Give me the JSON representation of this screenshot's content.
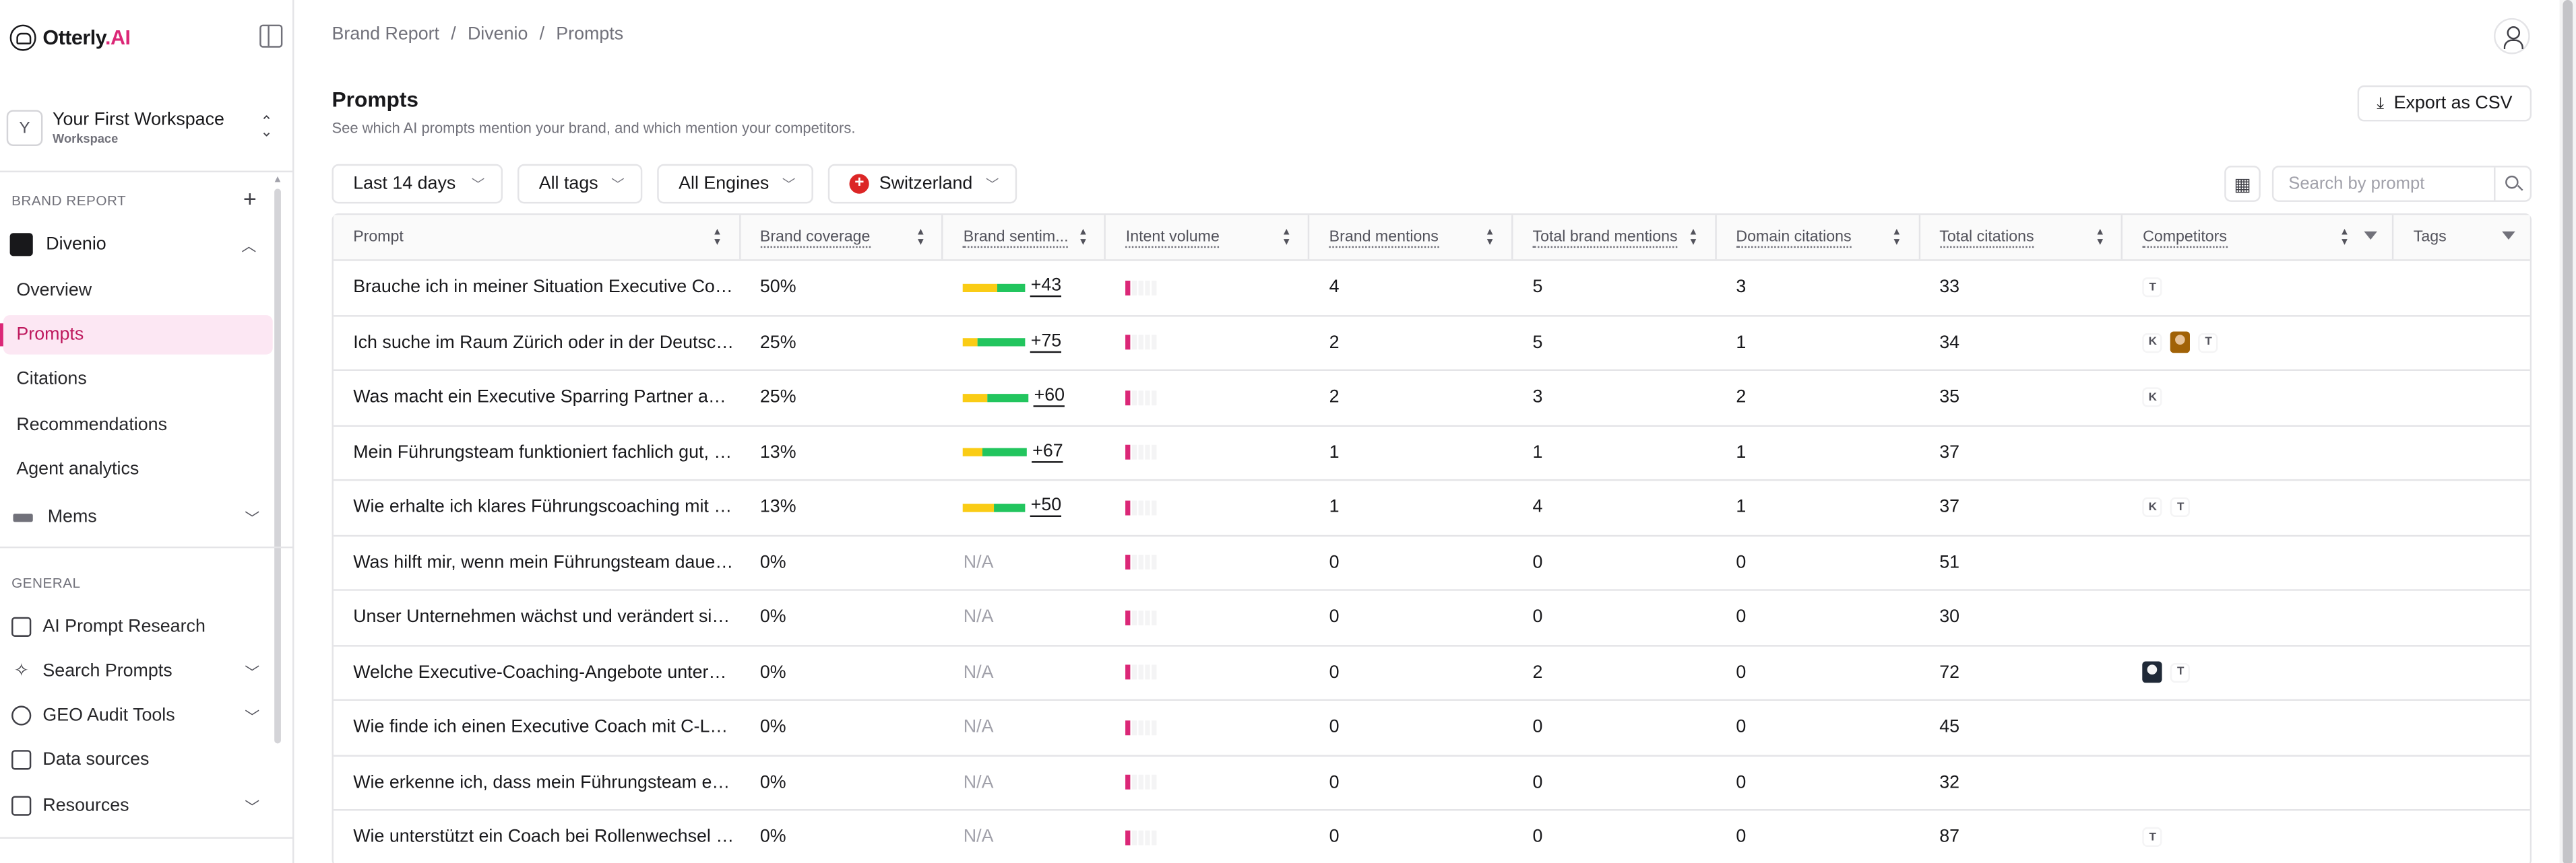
{
  "app": {
    "logo_main": "Otterly",
    "logo_ai": ".AI"
  },
  "workspace": {
    "avatar": "Y",
    "name": "Your First Workspace",
    "sub": "Workspace"
  },
  "sidebar": {
    "brand_report_label": "BRAND REPORT",
    "brand_name": "Divenio",
    "brand_items": [
      "Overview",
      "Prompts",
      "Citations",
      "Recommendations",
      "Agent analytics"
    ],
    "active_item": "Prompts",
    "mems_label": "Mems",
    "general_label": "GENERAL",
    "general_items": [
      {
        "label": "AI Prompt Research",
        "icon": "flask-icon"
      },
      {
        "label": "Search Prompts",
        "icon": "sparkle-icon"
      },
      {
        "label": "GEO Audit Tools",
        "icon": "globe-icon"
      },
      {
        "label": "Data sources",
        "icon": "database-icon"
      },
      {
        "label": "Resources",
        "icon": "book-icon"
      }
    ]
  },
  "breadcrumb": [
    "Brand Report",
    "/",
    "Divenio",
    "/",
    "Prompts"
  ],
  "page": {
    "title": "Prompts",
    "subtitle": "See which AI prompts mention your brand, and which mention your competitors.",
    "export_label": "Export as CSV"
  },
  "filters": {
    "date": "Last 14 days",
    "tags": "All tags",
    "engines": "All Engines",
    "country": "Switzerland"
  },
  "search": {
    "placeholder": "Search by prompt"
  },
  "table": {
    "headers": [
      "Prompt",
      "Brand coverage",
      "Brand sentim...",
      "Intent volume",
      "Brand mentions",
      "Total brand mentions",
      "Domain citations",
      "Total citations",
      "Competitors",
      "Tags"
    ],
    "rows": [
      {
        "prompt": "Brauche ich in meiner Situation Executive Coaching oder Sparring?",
        "coverage": "50%",
        "sentiment": "+43",
        "sent_y": 0.5,
        "sent_g": 0.4,
        "mentions": "4",
        "total_mentions": "5",
        "domain_citations": "3",
        "total_citations": "33",
        "competitors": [
          "T"
        ]
      },
      {
        "prompt": "Ich suche im Raum Zürich oder in der Deutschschweiz einen Coach",
        "coverage": "25%",
        "sentiment": "+75",
        "sent_y": 0.22,
        "sent_g": 0.7,
        "mentions": "2",
        "total_mentions": "5",
        "domain_citations": "1",
        "total_citations": "34",
        "competitors": [
          "K",
          "photo",
          "T"
        ]
      },
      {
        "prompt": "Was macht ein Executive Sparring Partner and wie arbeitet er?",
        "coverage": "25%",
        "sentiment": "+60",
        "sent_y": 0.35,
        "sent_g": 0.6,
        "mentions": "2",
        "total_mentions": "3",
        "domain_citations": "2",
        "total_citations": "35",
        "competitors": [
          "K"
        ]
      },
      {
        "prompt": "Mein Führungsteam funktioniert fachlich gut, aber menschlich nicht",
        "coverage": "13%",
        "sentiment": "+67",
        "sent_y": 0.28,
        "sent_g": 0.65,
        "mentions": "1",
        "total_mentions": "1",
        "domain_citations": "1",
        "total_citations": "37",
        "competitors": []
      },
      {
        "prompt": "Wie erhalte ich klares Führungscoaching mit sofortiger Wirkung?",
        "coverage": "13%",
        "sentiment": "+50",
        "sent_y": 0.45,
        "sent_g": 0.45,
        "mentions": "1",
        "total_mentions": "4",
        "domain_citations": "1",
        "total_citations": "37",
        "competitors": [
          "K",
          "T"
        ]
      },
      {
        "prompt": "Was hilft mir, wenn mein Führungsteam dauerhaft überlastet ist?",
        "coverage": "0%",
        "sentiment": "N/A",
        "mentions": "0",
        "total_mentions": "0",
        "domain_citations": "0",
        "total_citations": "51",
        "competitors": []
      },
      {
        "prompt": "Unser Unternehmen wächst und verändert sich schnell – was tun?",
        "coverage": "0%",
        "sentiment": "N/A",
        "mentions": "0",
        "total_mentions": "0",
        "domain_citations": "0",
        "total_citations": "30",
        "competitors": []
      },
      {
        "prompt": "Welche Executive-Coaching-Angebote unterstützen bei Transformation?",
        "coverage": "0%",
        "sentiment": "N/A",
        "mentions": "0",
        "total_mentions": "2",
        "domain_citations": "0",
        "total_citations": "72",
        "competitors": [
          "photo-dark",
          "T"
        ]
      },
      {
        "prompt": "Wie finde ich einen Executive Coach mit C-Level-Erfahrung?",
        "coverage": "0%",
        "sentiment": "N/A",
        "mentions": "0",
        "total_mentions": "0",
        "domain_citations": "0",
        "total_citations": "45",
        "competitors": []
      },
      {
        "prompt": "Wie erkenne ich, dass mein Führungsteam externe Hilfe braucht?",
        "coverage": "0%",
        "sentiment": "N/A",
        "mentions": "0",
        "total_mentions": "0",
        "domain_citations": "0",
        "total_citations": "32",
        "competitors": []
      },
      {
        "prompt": "Wie unterstützt ein Coach bei Rollenwechsel in der Geschäftsleitung?",
        "coverage": "0%",
        "sentiment": "N/A",
        "mentions": "0",
        "total_mentions": "0",
        "domain_citations": "0",
        "total_citations": "87",
        "competitors": [
          "T"
        ]
      }
    ]
  },
  "colors": {
    "accent": "#db2777",
    "active_bg": "#fce7f3",
    "sentiment_yellow": "#facc15",
    "sentiment_green": "#22c55e"
  }
}
